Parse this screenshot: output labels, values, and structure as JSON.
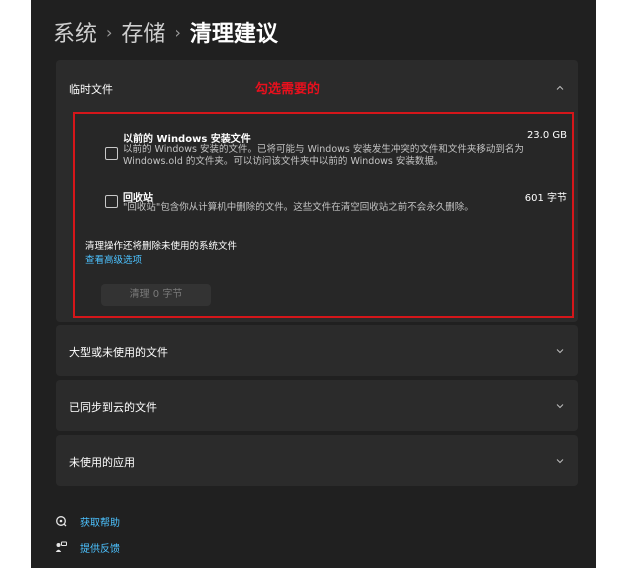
{
  "breadcrumb": {
    "items": [
      "系统",
      "存储",
      "清理建议"
    ],
    "separator": "›"
  },
  "annotation": {
    "text": "勾选需要的",
    "color": "#e8101d"
  },
  "sections": {
    "temp_files": {
      "title": "临时文件",
      "expanded": true,
      "chevron": "chevron-up-icon",
      "items": [
        {
          "title": "以前的 Windows 安装文件",
          "size": "23.0 GB",
          "description": "以前的 Windows 安装的文件。已将可能与 Windows 安装发生冲突的文件和文件夹移动到名为 Windows.old 的文件夹。可以访问该文件夹中以前的 Windows 安装数据。",
          "checked": false
        },
        {
          "title": "回收站",
          "size": "601 字节",
          "description": "\"回收站\"包含你从计算机中删除的文件。这些文件在清空回收站之前不会永久删除。",
          "checked": false
        }
      ],
      "note": "清理操作还将删除未使用的系统文件",
      "advanced_link": "查看高级选项",
      "clean_button": "清理 0 字节"
    },
    "large_files": {
      "title": "大型或未使用的文件",
      "chevron": "chevron-down-icon"
    },
    "synced_files": {
      "title": "已同步到云的文件",
      "chevron": "chevron-down-icon"
    },
    "unused_apps": {
      "title": "未使用的应用",
      "chevron": "chevron-down-icon"
    }
  },
  "footer": {
    "help": {
      "label": "获取帮助",
      "icon": "help-icon"
    },
    "feedback": {
      "label": "提供反馈",
      "icon": "feedback-icon"
    }
  },
  "colors": {
    "background": "#202020",
    "card": "#2b2b2b",
    "accent_link": "#4cc2ff",
    "highlight_border": "#d5161a"
  }
}
